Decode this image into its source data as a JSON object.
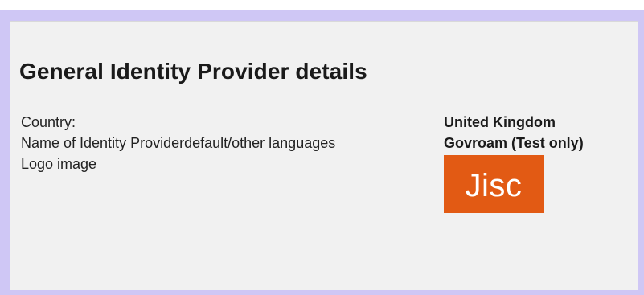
{
  "details": {
    "title": "General Identity Provider details",
    "rows": [
      {
        "label": "Country:",
        "value": "United Kingdom"
      },
      {
        "label": "Name of Identity Providerdefault/other languages",
        "value": "Govroam (Test only)"
      },
      {
        "label": "Logo image",
        "logo_text": "Jisc"
      }
    ]
  },
  "colors": {
    "frame": "#cfc7f5",
    "panel": "#f1f1f1",
    "logo_bg": "#e25a14"
  }
}
